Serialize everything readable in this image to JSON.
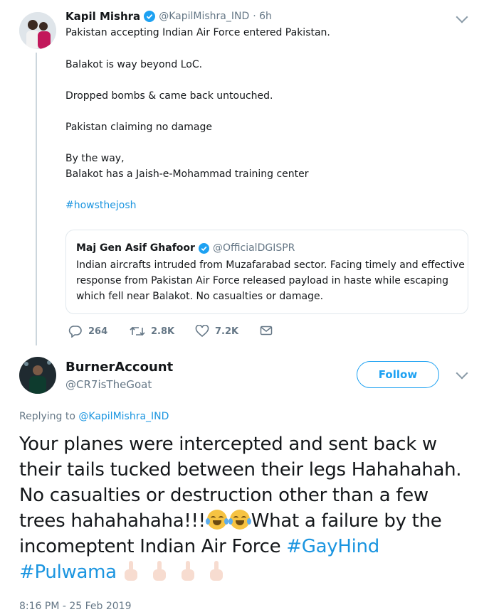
{
  "tweet": {
    "author_name": "Kapil Mishra",
    "handle": "@KapilMishra_IND",
    "time": "· 6h",
    "lines": [
      "Pakistan accepting Indian Air Force entered Pakistan.",
      "Balakot is way beyond LoC.",
      "Dropped bombs & came back untouched.",
      "Pakistan claiming no damage",
      "By the way,",
      "Balakot has a Jaish-e-Mohammad training center"
    ],
    "hashtag": "#howsthejosh",
    "quoted": {
      "author_name": "Maj Gen Asif Ghafoor",
      "handle": "@OfficialDGISPR",
      "lines": [
        "Indian aircrafts intruded from Muzafarabad sector. Facing timely and effective",
        "response from Pakistan Air Force released payload in haste while escaping",
        "which fell near Balakot. No casualties or damage."
      ]
    },
    "replies": "264",
    "retweets": "2.8K",
    "likes": "7.2K"
  },
  "reply": {
    "author_name": "BurnerAccount",
    "handle": "@CR7isTheGoat",
    "follow_label": "Follow",
    "replying_prefix": "Replying to ",
    "replying_to": "@KapilMishra_IND",
    "text_1": "Your planes were intercepted and sent back w their tails tucked between their legs Hahahahah. No casualties or destruction other than a few trees hahahahaha!!!",
    "text_2": "What a failure by the incomeptent Indian Air Force",
    "hashtag_1": "#GayHind",
    "hashtag_2": "#Pulwama",
    "timestamp": "8:16 PM - 25 Feb 2019"
  },
  "colors": {
    "link": "#1b95e0",
    "verified": "#1da1f2",
    "muted": "#657786"
  }
}
